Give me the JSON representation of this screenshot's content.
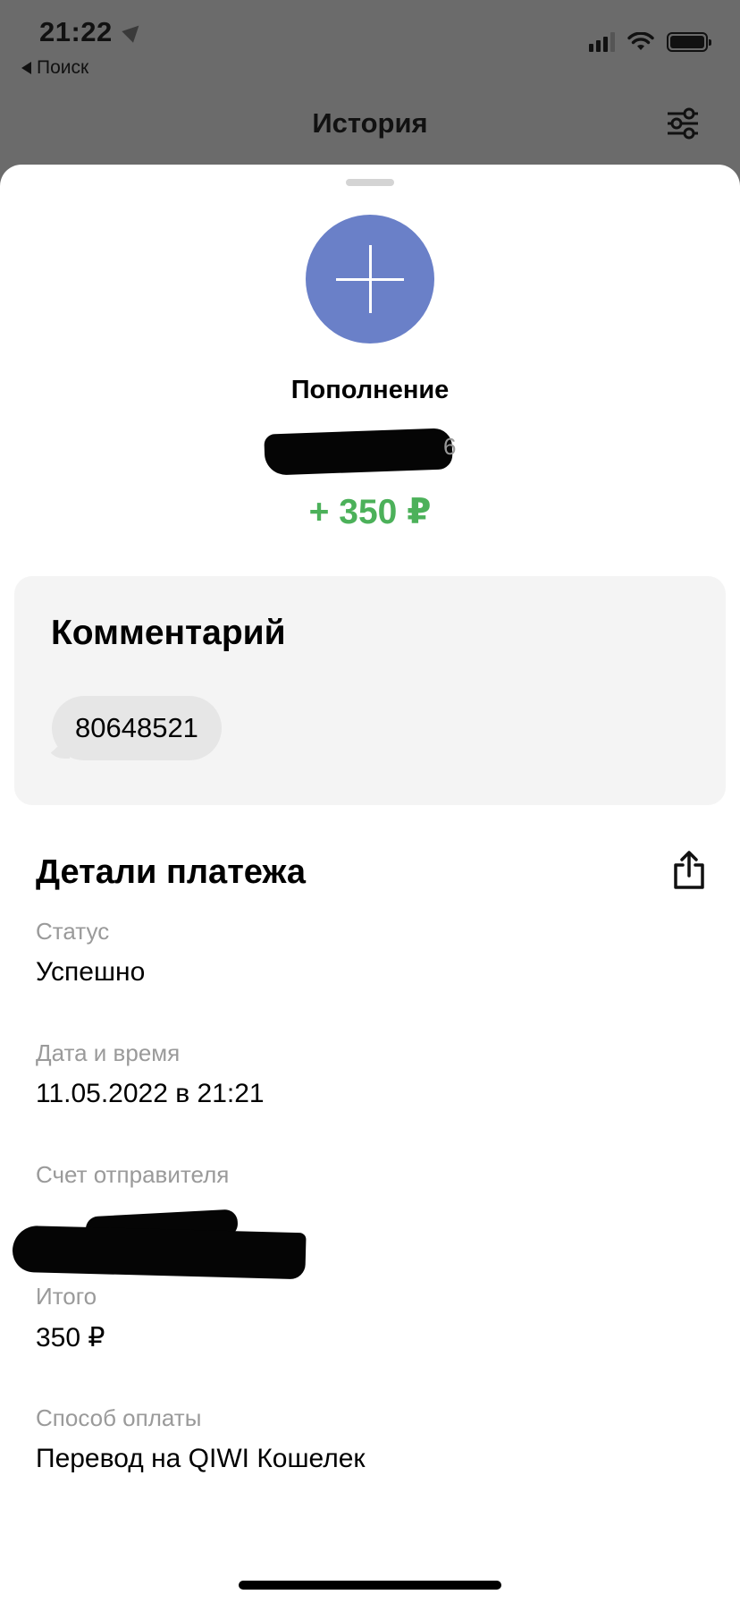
{
  "status_bar": {
    "time": "21:22",
    "back_label": "Поиск",
    "icons": [
      "location-arrow-icon",
      "signal-icon",
      "wifi-icon",
      "battery-icon"
    ]
  },
  "nav": {
    "title": "История",
    "filter_icon": "sliders-icon"
  },
  "transaction": {
    "icon": "plus-icon",
    "icon_color": "#6a80c8",
    "type": "Пополнение",
    "account_tail": "6",
    "amount": "+ 350 ₽",
    "amount_color": "#4cb15a"
  },
  "comment": {
    "title": "Комментарий",
    "text": "80648521"
  },
  "details": {
    "title": "Детали платежа",
    "share_icon": "share-icon",
    "fields": [
      {
        "label": "Статус",
        "value": "Успешно"
      },
      {
        "label": "Дата и время",
        "value": "11.05.2022 в 21:21"
      },
      {
        "label": "Счет отправителя",
        "value": ""
      },
      {
        "label": "Итого",
        "value": "350 ₽"
      },
      {
        "label": "Способ оплаты",
        "value": "Перевод на QIWI Кошелек"
      }
    ]
  }
}
